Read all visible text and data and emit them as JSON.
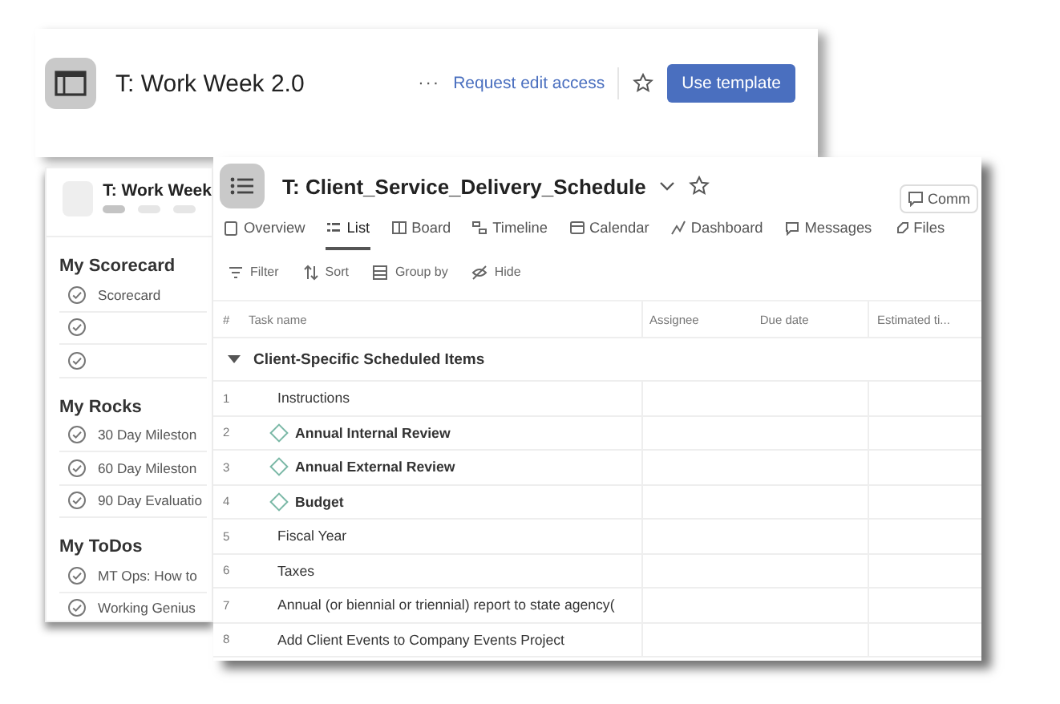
{
  "back_window": {
    "title": "T: Work Week 2.0",
    "more": "···",
    "request_link": "Request edit access",
    "use_template_button": "Use template"
  },
  "side_panel": {
    "title": "T: Work Week",
    "sections": [
      {
        "heading": "My Scorecard",
        "items": [
          {
            "kind": "task",
            "label": "Scorecard"
          },
          {
            "kind": "blank"
          },
          {
            "kind": "blank"
          }
        ]
      },
      {
        "heading": "My Rocks",
        "items": [
          {
            "kind": "task",
            "label": "30 Day Mileston"
          },
          {
            "kind": "task",
            "label": "60 Day Mileston"
          },
          {
            "kind": "task",
            "label": "90 Day Evaluatio"
          }
        ]
      },
      {
        "heading": "My ToDos",
        "items": [
          {
            "kind": "task",
            "label": "MT Ops: How to"
          },
          {
            "kind": "task",
            "label": "Working Genius"
          }
        ]
      }
    ]
  },
  "front_window": {
    "title": "T: Client_Service_Delivery_Schedule",
    "comment_button": "Comm",
    "tabs": [
      {
        "label": "Overview",
        "selected": false
      },
      {
        "label": "List",
        "selected": true
      },
      {
        "label": "Board",
        "selected": false
      },
      {
        "label": "Timeline",
        "selected": false
      },
      {
        "label": "Calendar",
        "selected": false
      },
      {
        "label": "Dashboard",
        "selected": false
      },
      {
        "label": "Messages",
        "selected": false
      },
      {
        "label": "Files",
        "selected": false
      }
    ],
    "toolbar": [
      "Filter",
      "Sort",
      "Group by",
      "Hide"
    ],
    "table": {
      "columns": [
        "#",
        "Task name",
        "Assignee",
        "Due date",
        "Estimated ti..."
      ],
      "group": {
        "title": "Client-Specific Scheduled Items",
        "expanded": true
      },
      "rows": [
        {
          "number": "1",
          "name": "Instructions",
          "kind": "task"
        },
        {
          "number": "2",
          "name": "Annual Internal Review",
          "kind": "milestone"
        },
        {
          "number": "3",
          "name": "Annual External Review",
          "kind": "milestone"
        },
        {
          "number": "4",
          "name": "Budget",
          "kind": "milestone"
        },
        {
          "number": "5",
          "name": "Fiscal Year",
          "kind": "task"
        },
        {
          "number": "6",
          "name": "Taxes",
          "kind": "task"
        },
        {
          "number": "7",
          "name": "Annual (or biennial or triennial) report to state agency(",
          "kind": "task"
        },
        {
          "number": "8",
          "name": "Add Client Events to Company Events Project",
          "kind": "task"
        }
      ]
    }
  }
}
